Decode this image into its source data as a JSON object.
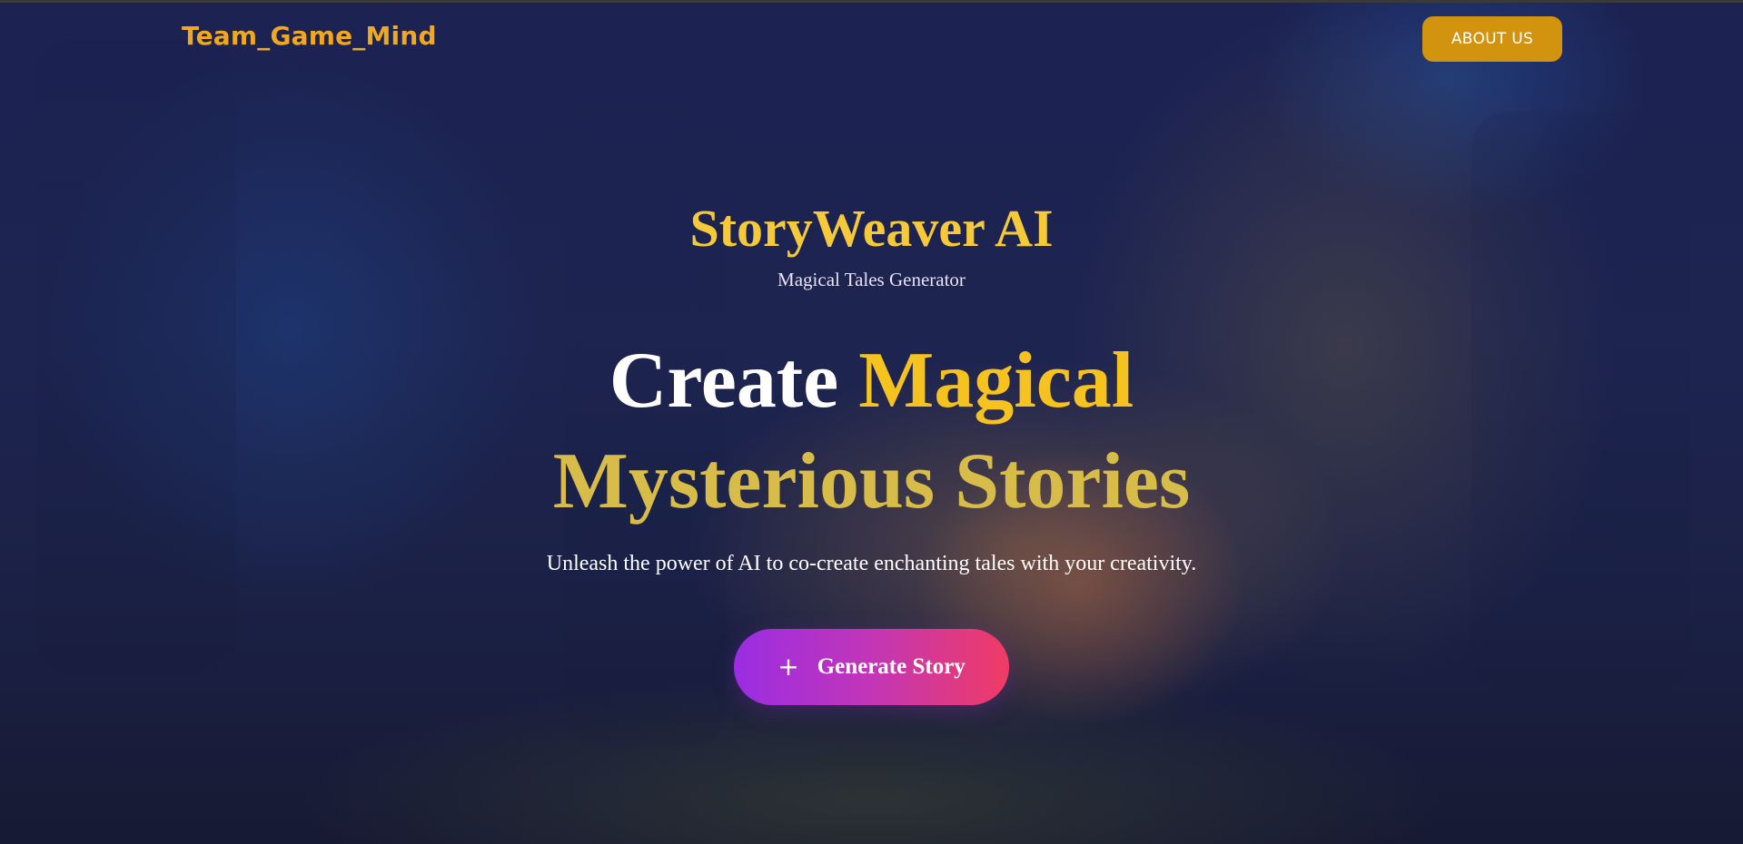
{
  "nav": {
    "brand": "Team_Game_Mind",
    "about_label": "ABOUT US"
  },
  "hero": {
    "app_title": "StoryWeaver AI",
    "app_subtitle": "Magical Tales Generator",
    "headline_word_1": "Create",
    "headline_word_2": "Magical",
    "headline_line_2": "Mysterious Stories",
    "tagline": "Unleash the power of AI to co-create enchanting tales with your creativity.",
    "cta_icon": "+",
    "cta_label": "Generate Story"
  },
  "colors": {
    "brand_accent": "#f0a820",
    "about_button": "#d2930e",
    "title_gold": "#f5c93a",
    "cta_gradient_start": "#9a2de3",
    "cta_gradient_end": "#f03b64"
  }
}
